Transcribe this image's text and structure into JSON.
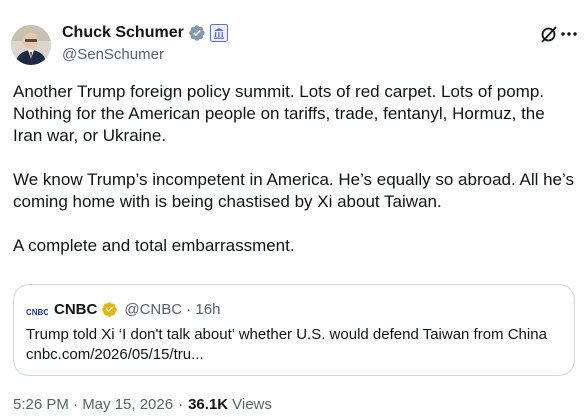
{
  "author": {
    "display_name": "Chuck Schumer",
    "handle": "@SenSchumer",
    "verified_color": "#829aab",
    "gov_badge_color": "#5b70d6"
  },
  "post": {
    "paragraph1": "Another Trump foreign policy summit. Lots of red carpet. Lots of pomp. Nothing for the American people on tariffs, trade, fentanyl, Hormuz, the Iran war, or Ukraine.",
    "paragraph2": "We know Trump’s incompetent in America. He’s equally so abroad. All he’s coming home with is being chastised by Xi about Taiwan.",
    "paragraph3": "A complete and total embarrassment."
  },
  "quote": {
    "logo_text": "CNBC",
    "name": "CNBC",
    "verified_color": "#e2b719",
    "handle_time": "@CNBC · 16h",
    "text": "Trump told Xi ‘I don't talk about’ whether U.S. would defend Taiwan from China",
    "link": "cnbc.com/2026/05/15/tru..."
  },
  "footer": {
    "timestamp": "5:26 PM · May 15, 2026",
    "separator": "·",
    "views_count": "36.1K",
    "views_label": "Views"
  },
  "icons": {
    "top_right_1": "grok-icon",
    "top_right_2": "more-menu-icon"
  }
}
